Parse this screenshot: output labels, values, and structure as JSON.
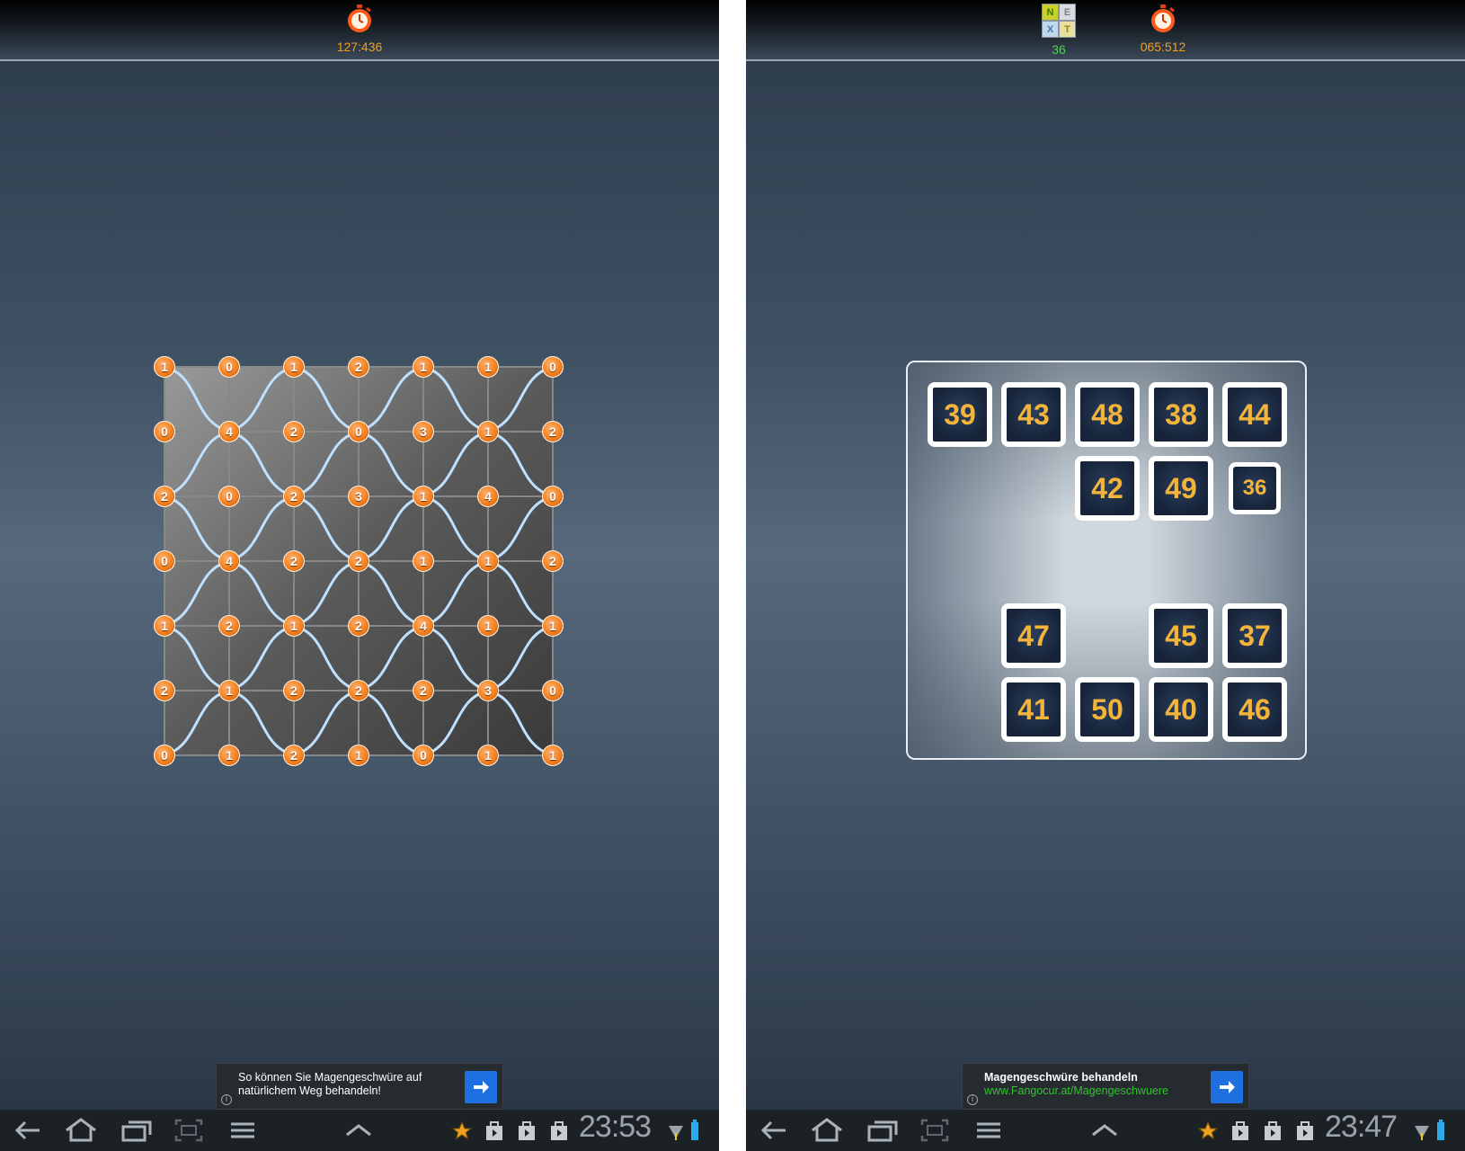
{
  "left": {
    "timer": "127:436",
    "grid": [
      [
        "1",
        "0",
        "1",
        "2",
        "1",
        "1",
        "0"
      ],
      [
        "0",
        "4",
        "2",
        "0",
        "3",
        "1",
        "2"
      ],
      [
        "2",
        "0",
        "2",
        "3",
        "1",
        "4",
        "0"
      ],
      [
        "0",
        "4",
        "2",
        "2",
        "1",
        "1",
        "2"
      ],
      [
        "1",
        "2",
        "1",
        "2",
        "4",
        "1",
        "1"
      ],
      [
        "2",
        "1",
        "2",
        "2",
        "2",
        "3",
        "0"
      ],
      [
        "0",
        "1",
        "2",
        "1",
        "0",
        "1",
        "1"
      ]
    ],
    "ad": {
      "line1": "So können Sie Magengeschwüre auf",
      "line2": "natürlichem Weg behandeln!"
    },
    "clock": "23:53"
  },
  "right": {
    "next_icon_letters": [
      "N",
      "E",
      "X",
      "T"
    ],
    "next_count": "36",
    "timer": "065:512",
    "tiles": {
      "t39": "39",
      "t43": "43",
      "t48": "48",
      "t38": "38",
      "t44": "44",
      "t42": "42",
      "t49": "49",
      "t36": "36",
      "t47": "47",
      "t45": "45",
      "t37": "37",
      "t41": "41",
      "t50": "50",
      "t40": "40",
      "t46": "46"
    },
    "ad": {
      "title": "Magengeschwüre behandeln",
      "url": "www.Fangocur.at/Magengeschwuere"
    },
    "clock": "23:47"
  },
  "colors": {
    "node_orange": "#f58220",
    "tile_number": "#f4b43a",
    "accent_blue": "#1e6fe0",
    "link_green": "#32c232"
  },
  "icons": [
    "stopwatch-icon",
    "back-icon",
    "home-icon",
    "recent-apps-icon",
    "screenshot-icon",
    "menu-icon",
    "chevron-up-icon",
    "star-icon",
    "bag-icon",
    "play-store-icon",
    "signal-icon",
    "battery-icon",
    "arrow-right-icon",
    "info-icon"
  ]
}
